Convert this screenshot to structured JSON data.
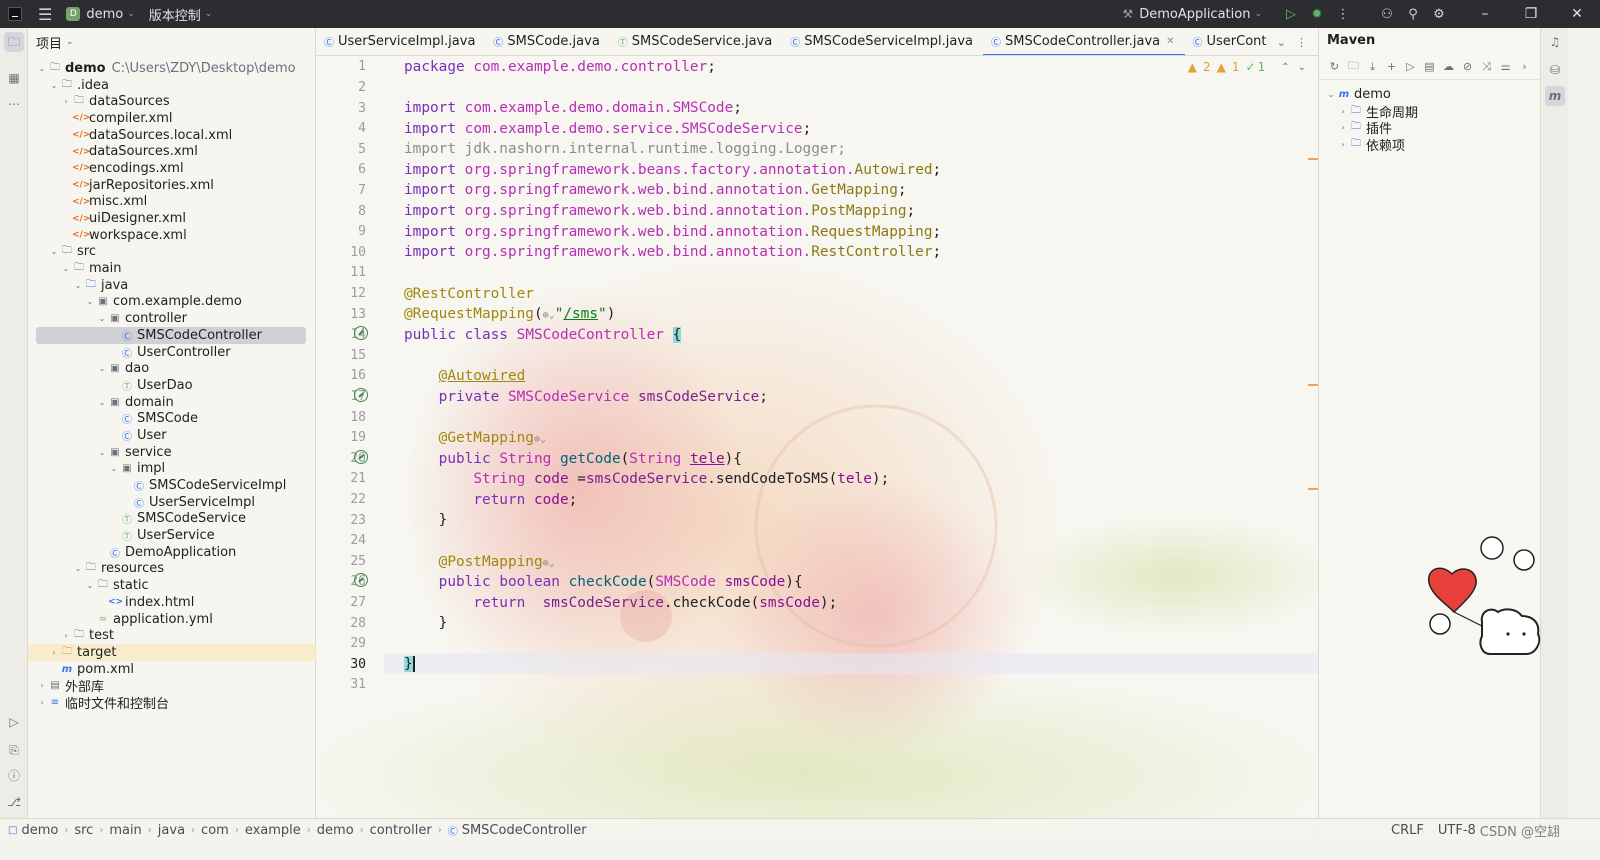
{
  "titlebar": {
    "project": "demo",
    "project_badge": "D",
    "vcs": "版本控制",
    "run_config": "DemoApplication"
  },
  "project_panel": {
    "title": "项目",
    "root_name": "demo",
    "root_path": "C:\\Users\\ZDY\\Desktop\\demo",
    "nodes": [
      {
        "label": ".idea"
      },
      {
        "label": "dataSources"
      },
      {
        "label": "compiler.xml"
      },
      {
        "label": "dataSources.local.xml"
      },
      {
        "label": "dataSources.xml"
      },
      {
        "label": "encodings.xml"
      },
      {
        "label": "jarRepositories.xml"
      },
      {
        "label": "misc.xml"
      },
      {
        "label": "uiDesigner.xml"
      },
      {
        "label": "workspace.xml"
      },
      {
        "label": "src"
      },
      {
        "label": "main"
      },
      {
        "label": "java"
      },
      {
        "label": "com.example.demo"
      },
      {
        "label": "controller"
      },
      {
        "label": "SMSCodeController"
      },
      {
        "label": "UserController"
      },
      {
        "label": "dao"
      },
      {
        "label": "UserDao"
      },
      {
        "label": "domain"
      },
      {
        "label": "SMSCode"
      },
      {
        "label": "User"
      },
      {
        "label": "service"
      },
      {
        "label": "impl"
      },
      {
        "label": "SMSCodeServiceImpl"
      },
      {
        "label": "UserServiceImpl"
      },
      {
        "label": "SMSCodeService"
      },
      {
        "label": "UserService"
      },
      {
        "label": "DemoApplication"
      },
      {
        "label": "resources"
      },
      {
        "label": "static"
      },
      {
        "label": "index.html"
      },
      {
        "label": "application.yml"
      },
      {
        "label": "test"
      },
      {
        "label": "target"
      },
      {
        "label": "pom.xml"
      },
      {
        "label": "外部库"
      },
      {
        "label": "临时文件和控制台"
      }
    ]
  },
  "tabs": [
    {
      "label": "UserServiceImpl.java"
    },
    {
      "label": "SMSCode.java"
    },
    {
      "label": "SMSCodeService.java"
    },
    {
      "label": "SMSCodeServiceImpl.java"
    },
    {
      "label": "SMSCodeController.java"
    },
    {
      "label": "UserContr"
    }
  ],
  "inspections": {
    "warnings_a": "2",
    "warnings_b": "1",
    "ok": "1"
  },
  "code": {
    "line_numbers": [
      "1",
      "2",
      "3",
      "4",
      "5",
      "6",
      "7",
      "8",
      "9",
      "10",
      "11",
      "12",
      "13",
      "14",
      "15",
      "16",
      "17",
      "18",
      "19",
      "20",
      "21",
      "22",
      "23",
      "24",
      "25",
      "26",
      "27",
      "28",
      "29",
      "30",
      "31"
    ],
    "current_line": "30",
    "t": {
      "package": "package",
      "pkg_name": "com.example.demo.controller",
      "semi": ";",
      "import": "import",
      "imp1": "com.example.demo.domain.",
      "imp1c": "SMSCode",
      "imp2": "com.example.demo.service.",
      "imp2c": "SMSCodeService",
      "imp3": "jdk.nashorn.internal.runtime.logging.Logger;",
      "imp4": "org.springframework.beans.factory.annotation.",
      "imp4c": "Autowired",
      "imp5": "org.springframework.web.bind.annotation.",
      "imp5c": "GetMapping",
      "imp6c": "PostMapping",
      "imp7c": "RequestMapping",
      "imp8c": "RestController",
      "ann_rest": "@RestController",
      "ann_req": "@RequestMapping",
      "paren_open": "(",
      "paren_close": ")",
      "quote": "\"",
      "sms_path": "/sms",
      "public": "public",
      "class": "class",
      "class_name": "SMSCodeController",
      "lbrace": "{",
      "rbrace": "}",
      "ann_auto": "@Autowired",
      "private": "private",
      "svc_type": "SMSCodeService",
      "svc_field": "smsCodeService",
      "ann_get": "@GetMapping",
      "String": "String",
      "getCode": "getCode",
      "tele": "tele",
      "code_var": "code",
      "eq": " =",
      "send_call": "sendCodeToSMS",
      "dot": ".",
      "return": "return",
      "ann_post": "@PostMapping",
      "boolean": "boolean",
      "checkCode": "checkCode",
      "sms_type": "SMSCode",
      "smsCode": "smsCode"
    }
  },
  "maven": {
    "title": "Maven",
    "root": "demo",
    "items": [
      {
        "label": "生命周期"
      },
      {
        "label": "插件"
      },
      {
        "label": "依赖项"
      }
    ]
  },
  "breadcrumb": [
    "demo",
    "src",
    "main",
    "java",
    "com",
    "example",
    "demo",
    "controller",
    "SMSCodeController"
  ],
  "statusbar": {
    "line_sep": "CRLF",
    "encoding": "UTF-8",
    "extra": "CSDN @空翃"
  }
}
